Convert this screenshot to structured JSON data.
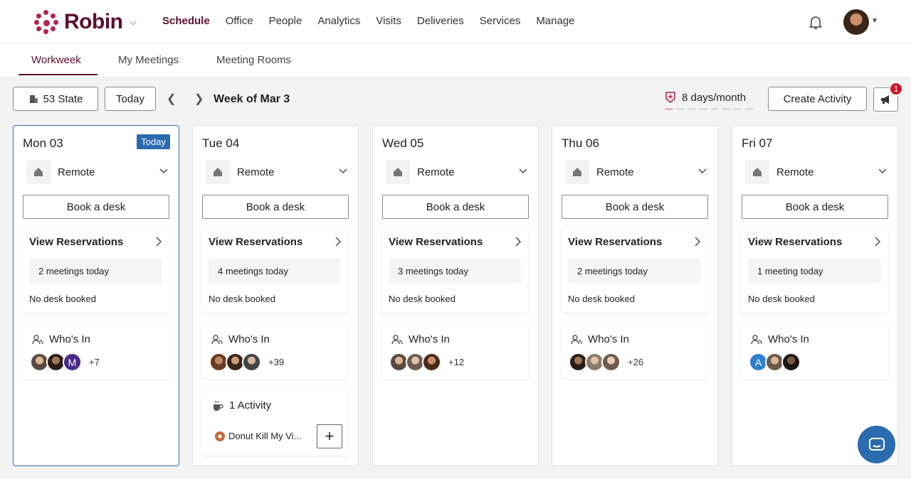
{
  "brand": {
    "name": "Robin"
  },
  "nav": [
    "Schedule",
    "Office",
    "People",
    "Analytics",
    "Visits",
    "Deliveries",
    "Services",
    "Manage"
  ],
  "subtabs": [
    "Workweek",
    "My Meetings",
    "Meeting Rooms"
  ],
  "toolbar": {
    "building": "53 State",
    "today": "Today",
    "week": "Week of Mar 3",
    "days_per_month": "8 days/month",
    "create": "Create Activity",
    "announcements_count": "1"
  },
  "days": [
    {
      "title": "Mon 03",
      "today_badge": "Today",
      "location": "Remote",
      "book": "Book a desk",
      "res_title": "View Reservations",
      "meetings": "2 meetings today",
      "desk": "No desk booked",
      "who": "Who's In",
      "count": "+7"
    },
    {
      "title": "Tue 04",
      "location": "Remote",
      "book": "Book a desk",
      "res_title": "View Reservations",
      "meetings": "4 meetings today",
      "desk": "No desk booked",
      "who": "Who's In",
      "count": "+39",
      "activity_title": "1 Activity",
      "activity_item": "Donut Kill My Vi..."
    },
    {
      "title": "Wed 05",
      "location": "Remote",
      "book": "Book a desk",
      "res_title": "View Reservations",
      "meetings": "3 meetings today",
      "desk": "No desk booked",
      "who": "Who's In",
      "count": "+12"
    },
    {
      "title": "Thu 06",
      "location": "Remote",
      "book": "Book a desk",
      "res_title": "View Reservations",
      "meetings": "2 meetings today",
      "desk": "No desk booked",
      "who": "Who's In",
      "count": "+26"
    },
    {
      "title": "Fri 07",
      "location": "Remote",
      "book": "Book a desk",
      "res_title": "View Reservations",
      "meetings": "1 meeting today",
      "desk": "No desk booked",
      "who": "Who's In",
      "avatar_letter": "A"
    }
  ],
  "avatar_letters": {
    "mon_m": "M"
  },
  "colors": {
    "brand": "#5b0f2e",
    "accent": "#b3234e",
    "today": "#2a6bb0",
    "badge": "#d0142a"
  }
}
